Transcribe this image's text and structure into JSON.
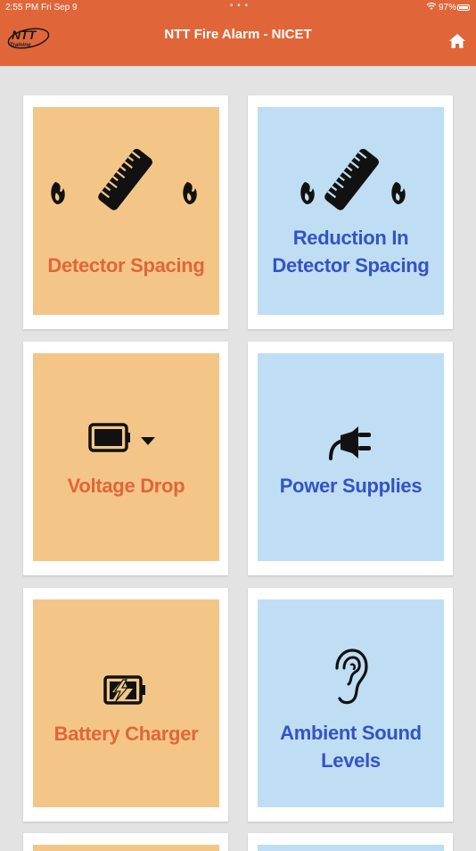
{
  "status_bar": {
    "time": "2:55 PM",
    "date": "Fri Sep 9",
    "dots": "• • •",
    "battery_percent": "97%",
    "icons": [
      "wifi-icon",
      "battery-icon"
    ]
  },
  "nav_bar": {
    "title": "NTT Fire Alarm - NICET",
    "logo_text": "NTT",
    "logo_sub": "Training",
    "home_icon": "home-icon"
  },
  "colors": {
    "accent": "#e0663a",
    "orange_tile": "#f3c688",
    "blue_tile": "#bfdef3",
    "blue_text": "#3552c6",
    "background": "#e3e3e3"
  },
  "tiles": [
    {
      "label_lines": [
        "Detector Spacing"
      ],
      "theme": "orange",
      "icon": "ruler-flames-icon"
    },
    {
      "label_lines": [
        "Reduction In",
        "Detector Spacing"
      ],
      "theme": "blue",
      "icon": "ruler-flames-icon"
    },
    {
      "label_lines": [
        "Voltage Drop"
      ],
      "theme": "orange",
      "icon": "battery-down-icon"
    },
    {
      "label_lines": [
        "Power Supplies"
      ],
      "theme": "blue",
      "icon": "plug-icon"
    },
    {
      "label_lines": [
        "Battery Charger"
      ],
      "theme": "orange",
      "icon": "battery-charging-icon"
    },
    {
      "label_lines": [
        "Ambient Sound",
        "Levels"
      ],
      "theme": "blue",
      "icon": "ear-icon"
    }
  ]
}
